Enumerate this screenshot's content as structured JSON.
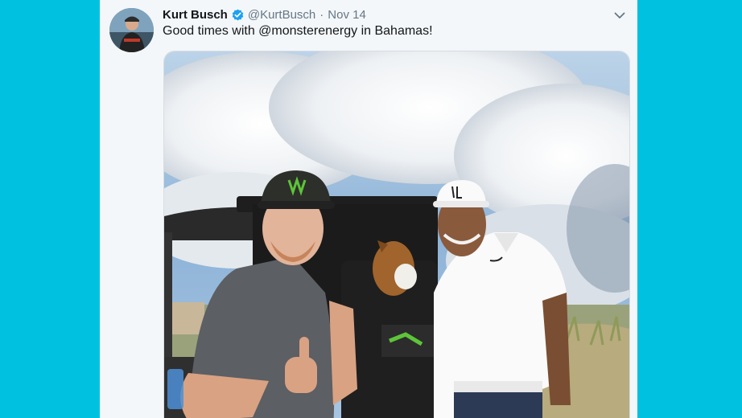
{
  "tweet": {
    "display_name": "Kurt Busch",
    "handle": "@KurtBusch",
    "separator": "·",
    "date": "Nov 14",
    "text_prefix": "Good times with ",
    "mention": "@monsterenergy",
    "text_suffix": " in Bahamas!",
    "verified": true
  },
  "icons": {
    "verified": "verified-badge-icon",
    "menu": "chevron-down-icon"
  },
  "colors": {
    "page_background": "#00c2e0",
    "card_background": "#f4f7f9",
    "verified_blue": "#1da1f2",
    "meta_gray": "#657786"
  }
}
